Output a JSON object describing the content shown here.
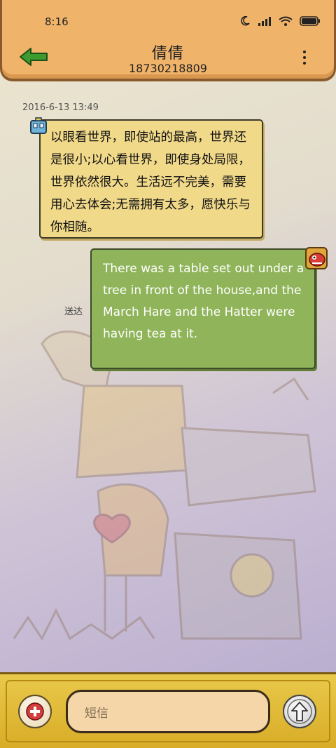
{
  "status_bar": {
    "time": "8:16"
  },
  "header": {
    "contact_name": "倩倩",
    "phone_number": "18730218809"
  },
  "conversation": {
    "timestamp": "2016-6-13 13:49",
    "incoming_message": "以眼看世界，即使站的最高，世界还是很小;以心看世界，即使身处局限，世界依然很大。生活远不完美，需要用心去体会;无需拥有太多，愿快乐与你相随。",
    "outgoing_message": "There was a table set out under a tree in front of the house,and the March Hare and the Hatter were having tea at it.",
    "delivery_status": "送达"
  },
  "composer": {
    "placeholder": "短信"
  },
  "colors": {
    "header_bg": "#f0b36a",
    "incoming_bubble": "#f1d98a",
    "outgoing_bubble": "#8fb459",
    "bottom_bar": "#d8ac27",
    "back_arrow": "#3c9a2e"
  },
  "icons": {
    "back": "back-arrow-icon",
    "menu": "more-vert-icon",
    "add": "plus-icon",
    "send": "send-arrow-up-icon"
  }
}
